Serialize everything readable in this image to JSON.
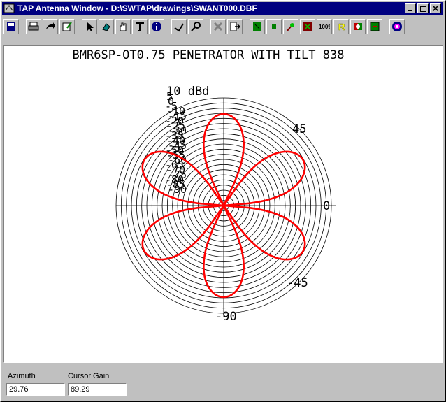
{
  "window": {
    "title": "TAP Antenna Window - D:\\SWTAP\\drawings\\SWANT000.DBF"
  },
  "toolbar": {
    "buttons": [
      {
        "icon": "save-icon"
      },
      {
        "icon": "print-icon"
      },
      {
        "icon": "export-arrow-icon"
      },
      {
        "icon": "edit-icon"
      },
      {
        "icon": "pointer-icon"
      },
      {
        "icon": "paint-icon"
      },
      {
        "icon": "hand-icon"
      },
      {
        "icon": "text-icon"
      },
      {
        "icon": "info-icon"
      },
      {
        "icon": "measure-icon"
      },
      {
        "icon": "zoom-icon"
      },
      {
        "icon": "delete-icon"
      },
      {
        "icon": "move-icon"
      },
      {
        "icon": "green-square-icon"
      },
      {
        "icon": "small-green-icon"
      },
      {
        "icon": "pin-icon"
      },
      {
        "icon": "red-square-icon"
      },
      {
        "icon": "zoom-100-icon",
        "label": "100%"
      },
      {
        "icon": "r-icon",
        "label": "R"
      },
      {
        "icon": "compare-icon"
      },
      {
        "icon": "green-box-icon"
      },
      {
        "icon": "target-icon"
      }
    ]
  },
  "plot": {
    "title": "BMR6SP-OT0.75 PENETRATOR WITH TILT 838",
    "scale_label": "10 dBd",
    "ring_labels": [
      "10",
      "5",
      "0",
      "-5",
      "-10",
      "-15",
      "-20",
      "-25",
      "-30",
      "-35",
      "-40",
      "-45",
      "-50",
      "-55",
      "-60",
      "-65",
      "-70",
      "-75",
      "-80",
      "-85",
      "-90"
    ],
    "angle_labels": {
      "a45": "45",
      "a0": "0",
      "am45": "-45",
      "am90": "-90"
    },
    "trace_color": "#ff0000",
    "lobes": [
      90,
      30,
      -30,
      -90,
      -150,
      150
    ]
  },
  "status": {
    "azimuth_label": "Azimuth",
    "azimuth_value": "29.76",
    "gain_label": "Cursor Gain",
    "gain_value": "89.29"
  }
}
